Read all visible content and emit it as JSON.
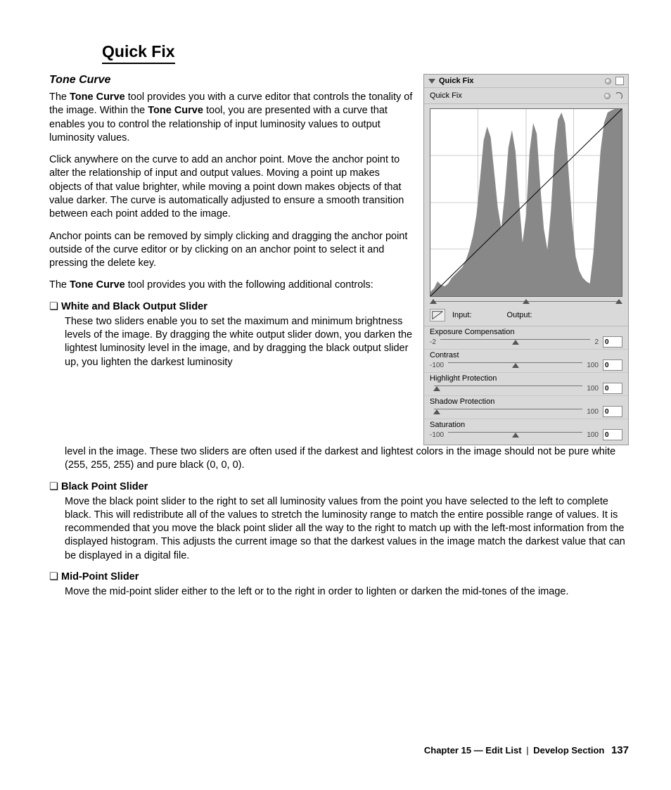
{
  "pageTitle": "Quick Fix",
  "subhead": "Tone Curve",
  "boldTerm": "Tone Curve",
  "para1a": "The ",
  "para1b": " tool provides you with a curve editor that controls the tonality of the image. Within the ",
  "para1c": " tool, you are presented with a curve that enables you to control the relationship of input luminosity values to output luminosity values.",
  "para2": "Click anywhere on the curve to add an anchor point. Move the anchor point to alter the relationship of input and output values. Moving a point up makes objects of that value brighter, while moving a point down makes objects of that value darker. The curve is automatically adjusted to ensure a smooth transition between each point added to the image.",
  "para3": "Anchor points can be removed by simply clicking and dragging the anchor point outside of the curve editor or by clicking on an anchor point to select it and pressing the delete key.",
  "para4a": "The ",
  "para4b": " tool provides you with the following additional controls:",
  "bullets": [
    {
      "head": "White and Black Output Slider",
      "body": "These two sliders enable you to set the maximum and minimum brightness levels of the image. By dragging the white output slider down, you darken the lightest luminosity level in the image, and by dragging the black output slider up, you lighten the darkest luminosity level in the image. These two sliders are often used if the darkest and lightest colors in the image should not be pure white (255, 255, 255) and pure black (0, 0, 0)."
    },
    {
      "head": "Black Point Slider",
      "body": "Move the black point slider to the right to set all luminosity values from the point you have selected to the left to complete black. This will redistribute all of the values to stretch the luminosity range to match the entire possible range of values. It is recommended that you move the black point slider all the way to the right to match up with the left-most information from the displayed histogram. This adjusts the current image so that the darkest values in the image match the darkest value that can be displayed in a digital file."
    },
    {
      "head": "Mid-Point Slider",
      "body": "Move the mid-point slider either to the left or to the right in order to lighten or darken the mid-tones of the image."
    }
  ],
  "footer": {
    "chapter": "Chapter 15 — Edit List",
    "section": "Develop Section",
    "page": "137"
  },
  "panel": {
    "header": "Quick Fix",
    "subheader": "Quick Fix",
    "inputLabel": "Input:",
    "outputLabel": "Output:",
    "controls": [
      {
        "name": "Exposure Compensation",
        "min": "-2",
        "max": "2",
        "value": "0",
        "pos": 50
      },
      {
        "name": "Contrast",
        "min": "-100",
        "max": "100",
        "value": "0",
        "pos": 50
      },
      {
        "name": "Highlight Protection",
        "min": "",
        "max": "100",
        "value": "0",
        "pos": 2
      },
      {
        "name": "Shadow Protection",
        "min": "",
        "max": "100",
        "value": "0",
        "pos": 2
      },
      {
        "name": "Saturation",
        "min": "-100",
        "max": "100",
        "value": "0",
        "pos": 50
      }
    ]
  }
}
